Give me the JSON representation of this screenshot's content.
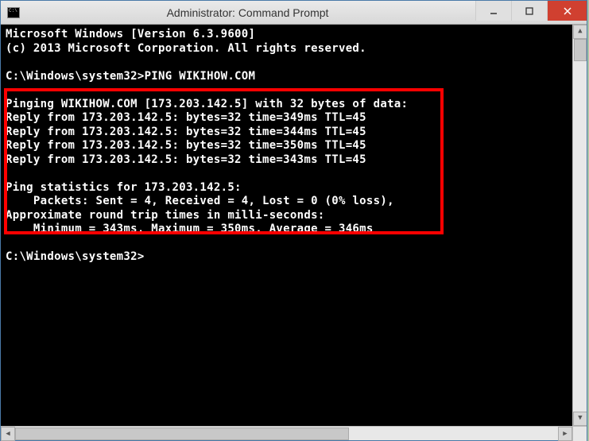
{
  "window": {
    "title": "Administrator: Command Prompt"
  },
  "terminal": {
    "line1": "Microsoft Windows [Version 6.3.9600]",
    "line2": "(c) 2013 Microsoft Corporation. All rights reserved.",
    "blank1": "",
    "prompt1": "C:\\Windows\\system32>PING WIKIHOW.COM",
    "blank2": "",
    "pinging": "Pinging WIKIHOW.COM [173.203.142.5] with 32 bytes of data:",
    "reply1": "Reply from 173.203.142.5: bytes=32 time=349ms TTL=45",
    "reply2": "Reply from 173.203.142.5: bytes=32 time=344ms TTL=45",
    "reply3": "Reply from 173.203.142.5: bytes=32 time=350ms TTL=45",
    "reply4": "Reply from 173.203.142.5: bytes=32 time=343ms TTL=45",
    "blank3": "",
    "stats1": "Ping statistics for 173.203.142.5:",
    "stats2": "    Packets: Sent = 4, Received = 4, Lost = 0 (0% loss),",
    "stats3": "Approximate round trip times in milli-seconds:",
    "stats4": "    Minimum = 343ms, Maximum = 350ms, Average = 346ms",
    "blank4": "",
    "prompt2": "C:\\Windows\\system32>"
  }
}
